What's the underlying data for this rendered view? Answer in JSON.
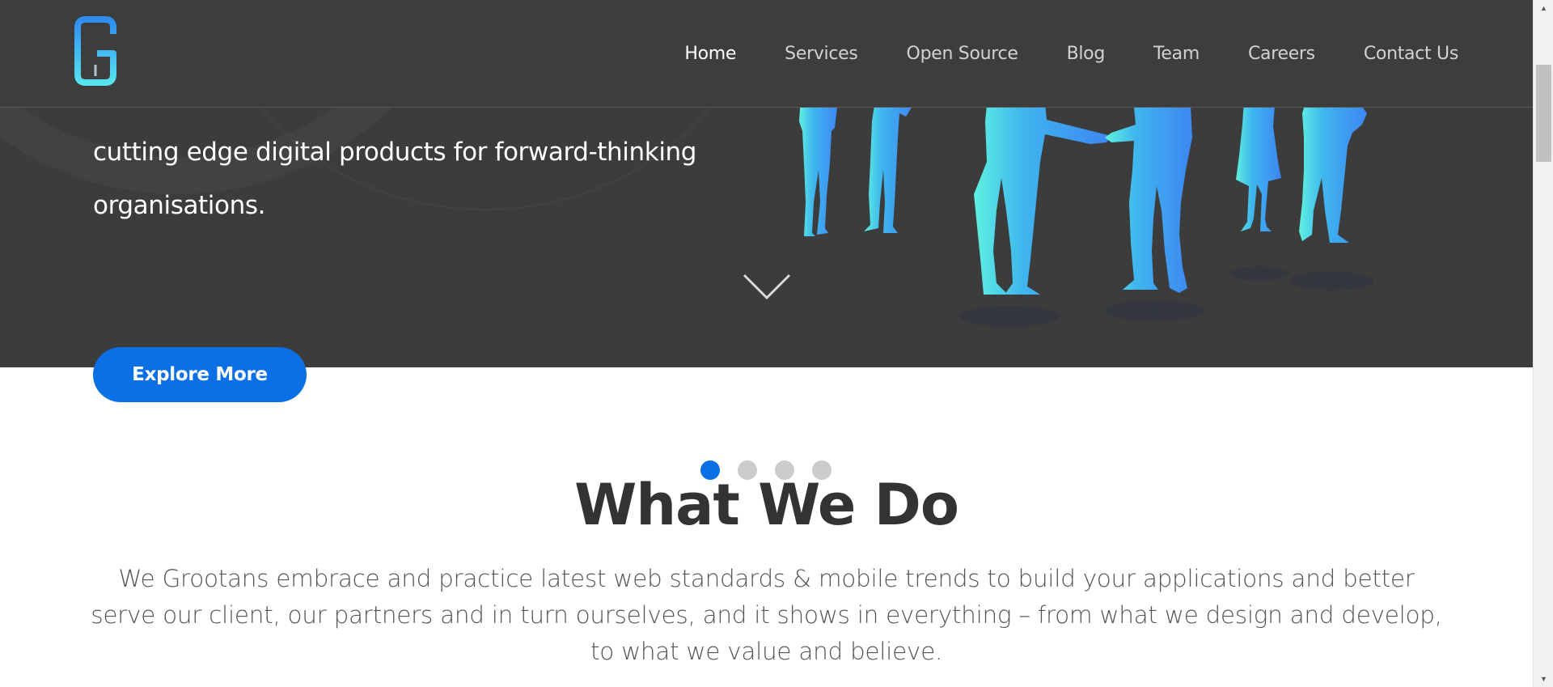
{
  "header": {
    "logo_icon": "grootans-g-logo",
    "nav": [
      {
        "label": "Home",
        "active": true
      },
      {
        "label": "Services",
        "active": false
      },
      {
        "label": "Open Source",
        "active": false
      },
      {
        "label": "Blog",
        "active": false
      },
      {
        "label": "Team",
        "active": false
      },
      {
        "label": "Careers",
        "active": false
      },
      {
        "label": "Contact Us",
        "active": false
      }
    ]
  },
  "hero": {
    "lines": [
      "cutting edge digital products for forward-thinking",
      "organisations."
    ],
    "explore_label": "Explore More",
    "scroll_icon": "chevron-down-icon"
  },
  "carousel": {
    "dot_count": 4,
    "active_index": 0
  },
  "what_we_do": {
    "title": "What We Do",
    "description": "We Grootans embrace and practice latest web standards & mobile trends to build your applications and better serve our client, our partners and in turn ourselves, and it shows in everything – from what we design and develop, to what we value and believe."
  },
  "colors": {
    "accent": "#0b6fe6",
    "hero_bg": "#3c3c3c",
    "illustration_gradient_start": "#5ef2e0",
    "illustration_gradient_end": "#3d86f2"
  },
  "scrollbar": {
    "up_icon": "scroll-up-arrow-icon",
    "down_icon": "scroll-down-arrow-icon"
  }
}
